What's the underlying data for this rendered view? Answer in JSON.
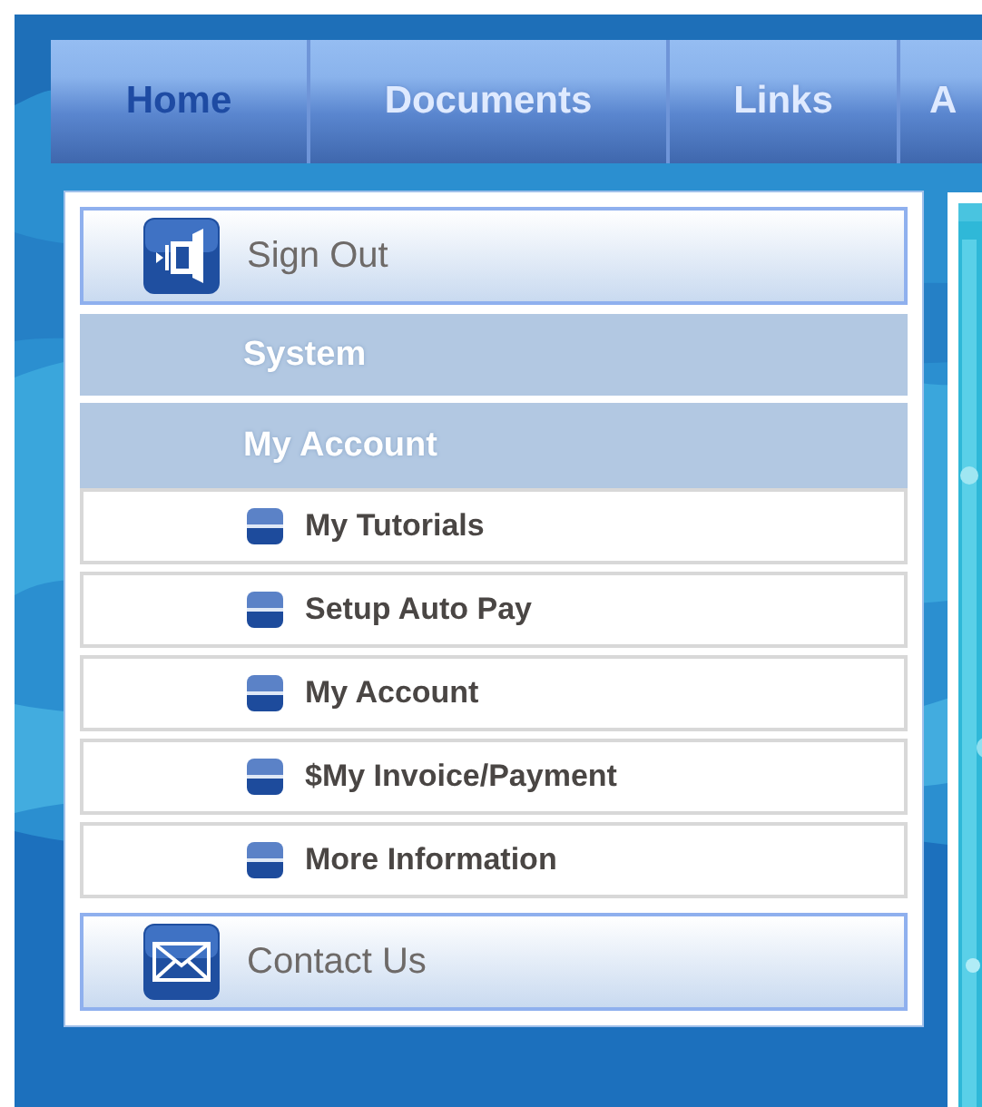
{
  "tabs": [
    {
      "label": "Home",
      "selected": true
    },
    {
      "label": "Documents",
      "selected": false
    },
    {
      "label": "Links",
      "selected": false
    },
    {
      "label": "A",
      "selected": false
    }
  ],
  "sidebar": {
    "items": [
      {
        "kind": "signout",
        "label": "Sign Out"
      },
      {
        "kind": "header",
        "label": "System"
      },
      {
        "kind": "header",
        "label": "My Account"
      },
      {
        "kind": "link",
        "label": "My Tutorials"
      },
      {
        "kind": "link",
        "label": "Setup Auto Pay"
      },
      {
        "kind": "link",
        "label": "My Account"
      },
      {
        "kind": "link",
        "label": "$My Invoice/Payment"
      },
      {
        "kind": "link",
        "label": "More Information"
      },
      {
        "kind": "contact",
        "label": "Contact Us"
      }
    ]
  }
}
